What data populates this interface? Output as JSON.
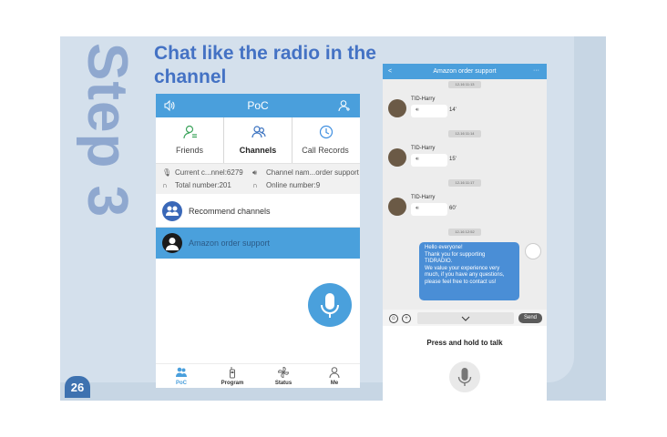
{
  "slide": {
    "page_number": "26",
    "step_label": "Step 3",
    "headline": "Chat like the radio in the channel"
  },
  "left_phone": {
    "header_title": "PoC",
    "tabs": [
      {
        "label": "Friends",
        "icon": "friends-icon"
      },
      {
        "label": "Channels",
        "icon": "channels-icon",
        "active": true
      },
      {
        "label": "Call Records",
        "icon": "clock-icon"
      }
    ],
    "info": {
      "current_channel": "Current c...nnel:6279",
      "channel_name": "Channel nam...order support",
      "total_number": "Total number:201",
      "online_number": "Online number:9"
    },
    "list": [
      {
        "label": "Recommend channels"
      },
      {
        "label": "Amazon order support",
        "selected": true
      }
    ],
    "nav": [
      {
        "label": "PoC",
        "active": true
      },
      {
        "label": "Program"
      },
      {
        "label": "Status"
      },
      {
        "label": "Me"
      }
    ]
  },
  "right_phone": {
    "header_title": "Amazon order support",
    "back": "<",
    "more": "···",
    "timestamps": [
      "12-16 11:13",
      "12-16 11:14",
      "12-16 11:17",
      "12-16 12:52"
    ],
    "messages": [
      {
        "sender": "TID-Harry",
        "duration": "14'"
      },
      {
        "sender": "TID-Harry",
        "duration": "15'"
      },
      {
        "sender": "TID-Harry",
        "duration": "60'"
      }
    ],
    "my_message": "Hello everyone!\nThank you for supporting TIDRADIO.\nWe value your experience very much, if you have any questions, please feel free to contact us!",
    "send_label": "Send",
    "hold_label": "Press and hold to talk"
  },
  "colors": {
    "accent": "#4a9fdc",
    "headline": "#4472c4",
    "step": "#8fa8cf",
    "selected_row": "#4aa0dc"
  }
}
